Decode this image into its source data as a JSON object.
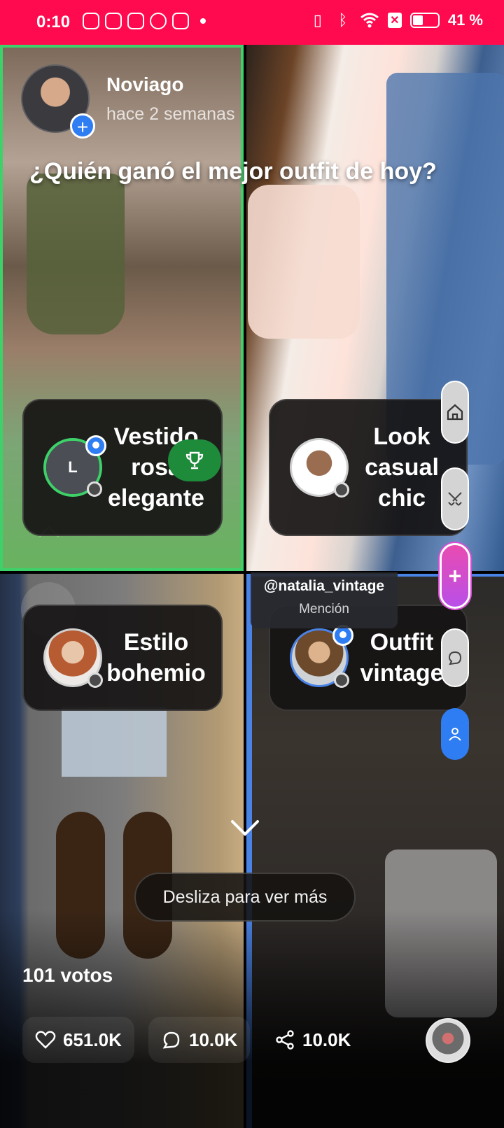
{
  "status_bar": {
    "time": "0:10",
    "battery_pct": "41 %",
    "battery_level": 0.41
  },
  "post": {
    "author": "Noviago",
    "time_ago": "hace 2 semanas",
    "question": "¿Quién ganó el mejor outfit de hoy?",
    "follow_symbol": "+"
  },
  "options": [
    {
      "title_lines": [
        "Vestido",
        "rosa",
        "elegante"
      ],
      "avatar_letter": "L",
      "selected": true,
      "winner": true
    },
    {
      "title_lines": [
        "Look",
        "casual",
        "chic"
      ],
      "selected": false
    },
    {
      "title_lines": [
        "Estilo",
        "bohemio"
      ],
      "selected": false
    },
    {
      "title_lines": [
        "Outfit",
        "vintage"
      ],
      "selected": true
    }
  ],
  "mention": {
    "handle": "@natalia_vintage",
    "label": "Mención"
  },
  "side_actions": {
    "home_icon": "home-icon",
    "battle_icon": "crossed-swords-icon",
    "create_symbol": "+",
    "comment_icon": "comment-icon",
    "profile_icon": "person-icon"
  },
  "swipe_hint": "Desliza para ver más",
  "votes": "101 votos",
  "actions": {
    "likes": "651.0K",
    "comments": "10.0K",
    "shares": "10.0K"
  },
  "colors": {
    "status_bar": "#ff0a4e",
    "selected_green": "#3ed16a",
    "selected_blue": "#4a83e6",
    "accent_pink": "#d94bd6",
    "trophy_green": "#1e8b3b"
  }
}
